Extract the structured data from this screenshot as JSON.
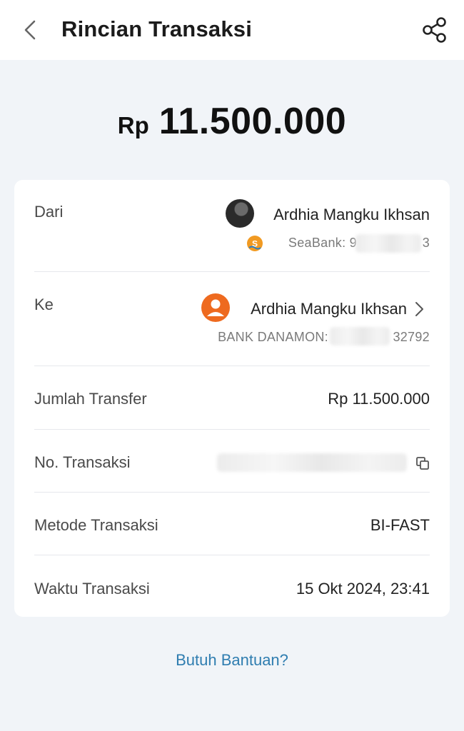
{
  "header": {
    "title": "Rincian Transaksi",
    "back_icon": "chevron-left-icon",
    "share_icon": "share-icon"
  },
  "amount": {
    "currency": "Rp",
    "value": "11.500.000"
  },
  "details": {
    "from": {
      "label": "Dari",
      "name": "Ardhia Mangku Ikhsan",
      "bank_prefix": "SeaBank: 9",
      "bank_suffix": "3"
    },
    "to": {
      "label": "Ke",
      "name": "Ardhia Mangku Ikhsan",
      "bank_prefix": "BANK DANAMON:",
      "bank_suffix": "32792"
    },
    "amount_row": {
      "label": "Jumlah Transfer",
      "value": "Rp 11.500.000"
    },
    "transaction_no": {
      "label": "No. Transaksi",
      "copy_icon": "copy-icon"
    },
    "method": {
      "label": "Metode Transaksi",
      "value": "BI-FAST"
    },
    "time": {
      "label": "Waktu Transaksi",
      "value": "15 Okt 2024, 23:41"
    }
  },
  "help": {
    "label": "Butuh Bantuan?"
  },
  "colors": {
    "accent_link": "#2f7db0",
    "avatar_orange": "#ee6a1f",
    "seabank_orange": "#f19a22",
    "background": "#f1f4f8"
  }
}
